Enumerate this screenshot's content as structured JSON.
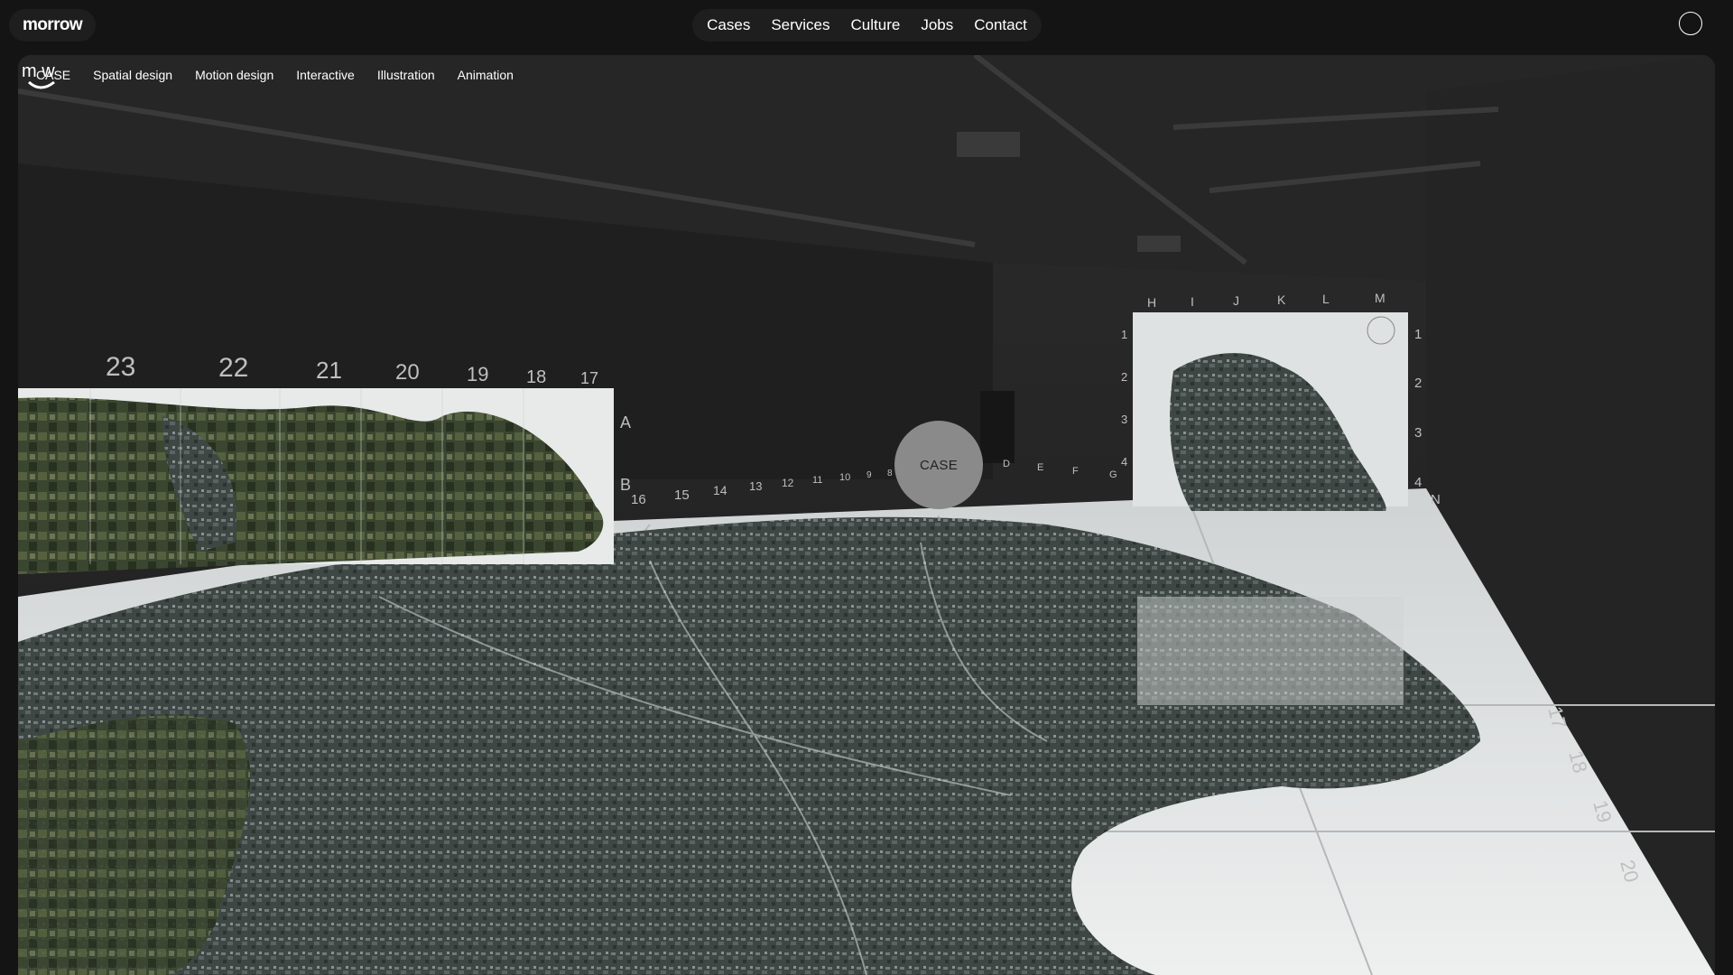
{
  "header": {
    "logo": "morrow",
    "nav": [
      "Cases",
      "Services",
      "Culture",
      "Jobs",
      "Contact"
    ]
  },
  "hero": {
    "tags": [
      "CASE",
      "Spatial design",
      "Motion design",
      "Interactive",
      "Illustration",
      "Animation"
    ],
    "badge": "CASE",
    "left_wall_columns": [
      "23",
      "22",
      "21",
      "20",
      "19",
      "18",
      "17"
    ],
    "left_wall_rows": [
      "A",
      "B"
    ],
    "floor_numbers": [
      "16",
      "15",
      "14",
      "13",
      "12",
      "11",
      "10",
      "9",
      "8"
    ],
    "floor_letters": [
      "D",
      "E",
      "F",
      "G"
    ],
    "right_wall_columns": [
      "H",
      "I",
      "J",
      "K",
      "L",
      "M"
    ],
    "right_wall_rows_left": [
      "1",
      "2",
      "3",
      "4"
    ],
    "right_wall_rows_right": [
      "1",
      "2",
      "3",
      "4"
    ],
    "right_wall_corner": "N",
    "side_wall_numbers": [
      "17",
      "18",
      "19",
      "20"
    ]
  },
  "footer_mark": "m w"
}
